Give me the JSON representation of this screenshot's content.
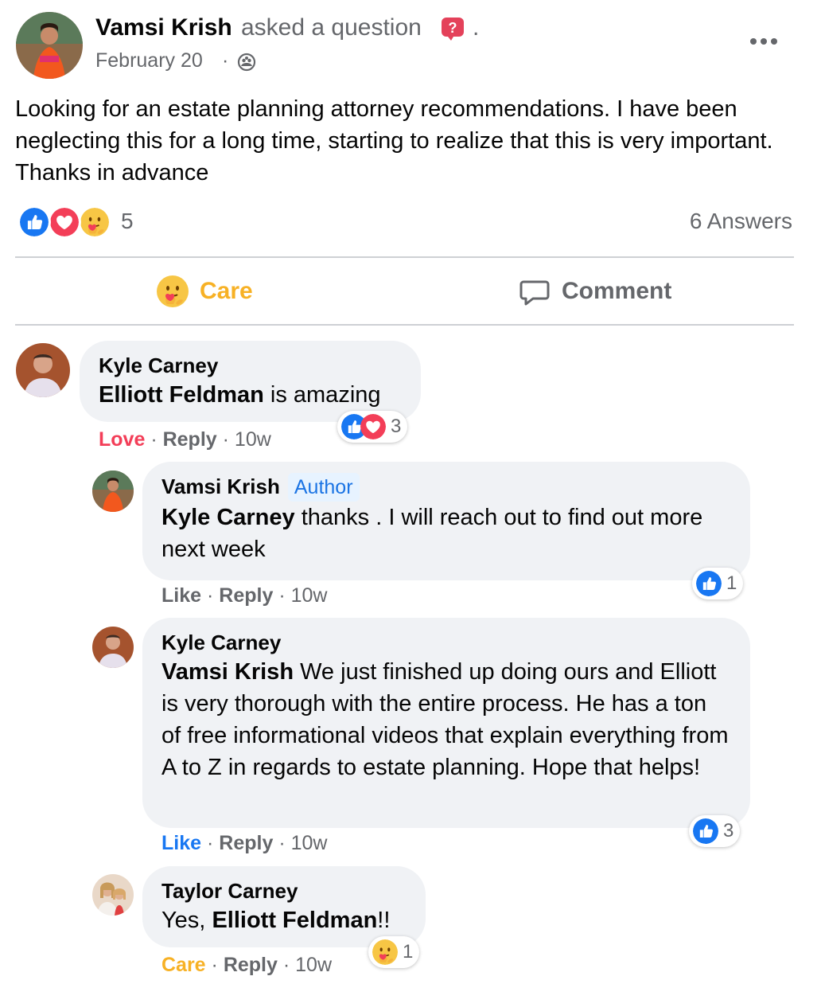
{
  "post": {
    "author": "Vamsi Krish",
    "action": "asked a question",
    "trailing_dot": ".",
    "date": "February 20",
    "date_separator": "·",
    "body": "Looking for an estate planning attorney recommendations. I have been neglecting this for a long time, starting to realize that this is very important. Thanks in advance",
    "reactions": {
      "icons": [
        "like-icon",
        "love-icon",
        "care-icon"
      ],
      "count": "5"
    },
    "answers": "6 Answers",
    "more_icon": "more-options-icon",
    "audience_icon": "group-audience-icon"
  },
  "actions": {
    "care_label": "Care",
    "comment_label": "Comment"
  },
  "comments": [
    {
      "author": "Kyle Carney",
      "mention": "Elliott Feldman",
      "text": " is amazing",
      "reaction_label": "Love",
      "reply": "Reply",
      "sep": "·",
      "time": "10w",
      "reactions": {
        "icons": [
          "like-icon",
          "love-icon"
        ],
        "count": "3"
      }
    },
    {
      "author": "Vamsi Krish",
      "badge": "Author",
      "mention": "Kyle Carney",
      "text": " thanks . I will reach out to find out more next week",
      "reaction_label": "Like",
      "reply": "Reply",
      "sep": "·",
      "time": "10w",
      "reactions": {
        "icons": [
          "like-icon"
        ],
        "count": "1"
      }
    },
    {
      "author": "Kyle Carney",
      "mention": "Vamsi Krish",
      "text": " We just finished up doing ours and Elliott is very thorough with the entire process. He has a ton of free informational videos that explain everything from A to Z in regards to estate planning. Hope that helps!",
      "reaction_label": "Like",
      "reply": "Reply",
      "sep": "·",
      "time": "10w",
      "reactions": {
        "icons": [
          "like-icon"
        ],
        "count": "3"
      }
    },
    {
      "author": "Taylor Carney",
      "text_before": "Yes, ",
      "mention": "Elliott Feldman",
      "text_after": "!!",
      "reaction_label": "Care",
      "reply": "Reply",
      "sep": "·",
      "time": "10w",
      "reactions": {
        "icons": [
          "care-icon"
        ],
        "count": "1"
      }
    }
  ],
  "colors": {
    "like": "#1877f2",
    "love": "#f33e58",
    "care": "#f7b125",
    "secondary_text": "#65676b",
    "bubble": "#f0f2f5",
    "question_badge": "#e4415a"
  }
}
